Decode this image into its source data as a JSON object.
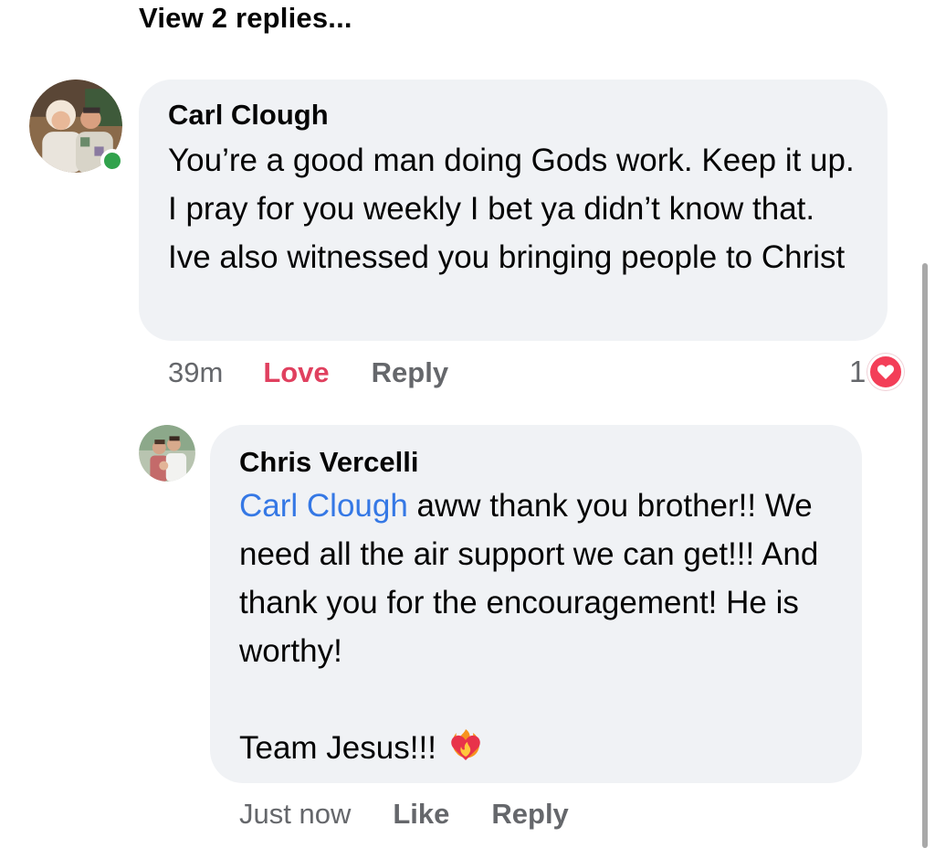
{
  "thread": {
    "view_replies_label": "View 2 replies..."
  },
  "comment": {
    "author": "Carl Clough",
    "text": "You’re a good man doing Gods work. Keep it up. I pray for you weekly I bet ya didn’t know that. Ive also witnessed you bringing people to Christ",
    "time": "39m",
    "reaction_label": "Love",
    "reply_label": "Reply",
    "reaction_count": "1",
    "reaction_icon": "heart-icon",
    "online": true
  },
  "reply": {
    "author": "Chris Vercelli",
    "mention": "Carl Clough",
    "text": " aww thank you brother!! We need all the air support we can get!!! And thank you for the encouragement! He is worthy!\n\nTeam Jesus!!! ",
    "emoji": "heart-on-fire-emoji",
    "time": "Just now",
    "like_label": "Like",
    "reply_label": "Reply"
  },
  "colors": {
    "bubble": "#f0f2f5",
    "mention": "#3578e5",
    "love": "#e0405f",
    "muted": "#65676b",
    "online": "#31a24c"
  }
}
